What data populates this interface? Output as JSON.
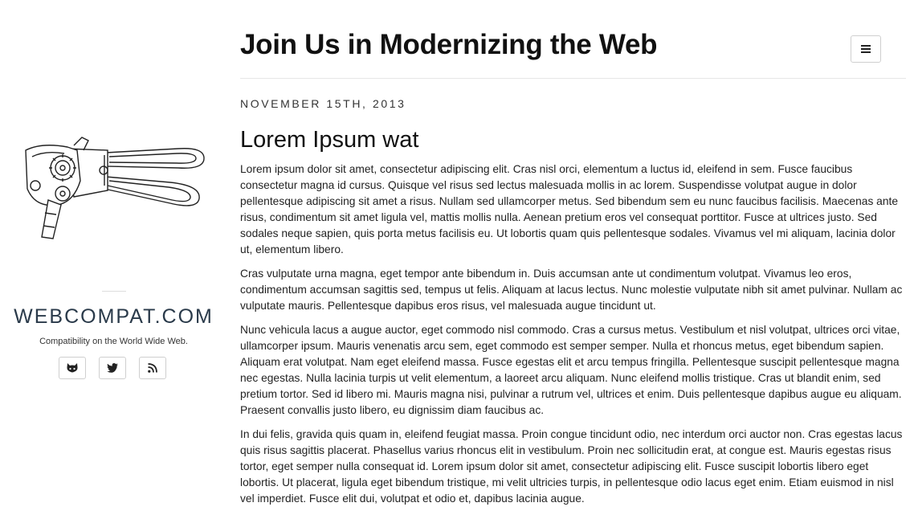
{
  "sidebar": {
    "site_name": "WEBCOMPAT.COM",
    "tagline": "Compatibility on the World Wide Web.",
    "social": [
      {
        "icon": "github-icon"
      },
      {
        "icon": "twitter-icon"
      },
      {
        "icon": "rss-icon"
      }
    ]
  },
  "header": {
    "title": "Join Us in Modernizing the Web",
    "menu_icon": "hamburger-menu-icon"
  },
  "post": {
    "date": "NOVEMBER 15TH, 2013",
    "title": "Lorem Ipsum wat",
    "paragraphs": [
      "Lorem ipsum dolor sit amet, consectetur adipiscing elit. Cras nisl orci, elementum a luctus id, eleifend in sem. Fusce faucibus consectetur magna id cursus. Quisque vel risus sed lectus malesuada mollis in ac lorem. Suspendisse volutpat augue in dolor pellentesque adipiscing sit amet a risus. Nullam sed ullamcorper metus. Sed bibendum sem eu nunc faucibus facilisis. Maecenas ante risus, condimentum sit amet ligula vel, mattis mollis nulla. Aenean pretium eros vel consequat porttitor. Fusce at ultrices justo. Sed sodales neque sapien, quis porta metus facilisis eu. Ut lobortis quam quis pellentesque sodales. Vivamus vel mi aliquam, lacinia dolor ut, elementum libero.",
      "Cras vulputate urna magna, eget tempor ante bibendum in. Duis accumsan ante ut condimentum volutpat. Vivamus leo eros, condimentum accumsan sagittis sed, tempus ut felis. Aliquam at lacus lectus. Nunc molestie vulputate nibh sit amet pulvinar. Nullam ac vulputate mauris. Pellentesque dapibus eros risus, vel malesuada augue tincidunt ut.",
      "Nunc vehicula lacus a augue auctor, eget commodo nisl commodo. Cras a cursus metus. Vestibulum et nisl volutpat, ultrices orci vitae, ullamcorper ipsum. Mauris venenatis arcu sem, eget commodo est semper semper. Nulla et rhoncus metus, eget bibendum sapien. Aliquam erat volutpat. Nam eget eleifend massa. Fusce egestas elit et arcu tempus fringilla. Pellentesque suscipit pellentesque magna nec egestas. Nulla lacinia turpis ut velit elementum, a laoreet arcu aliquam. Nunc eleifend mollis tristique. Cras ut blandit enim, sed pretium tortor. Sed id libero mi. Mauris magna nisi, pulvinar a rutrum vel, ultrices et enim. Duis pellentesque dapibus augue eu aliquam. Praesent convallis justo libero, eu dignissim diam faucibus ac.",
      "In dui felis, gravida quis quam in, eleifend feugiat massa. Proin congue tincidunt odio, nec interdum orci auctor non. Cras egestas lacus quis risus sagittis placerat. Phasellus varius rhoncus elit in vestibulum. Proin nec sollicitudin erat, at congue est. Mauris egestas risus tortor, eget semper nulla consequat id. Lorem ipsum dolor sit amet, consectetur adipiscing elit. Fusce suscipit lobortis libero eget lobortis. Ut placerat, ligula eget bibendum tristique, mi velit ultricies turpis, in pellentesque odio lacus eget enim. Etiam euismod in nisl vel imperdiet. Fusce elit dui, volutpat et odio et, dapibus lacinia augue."
    ]
  }
}
